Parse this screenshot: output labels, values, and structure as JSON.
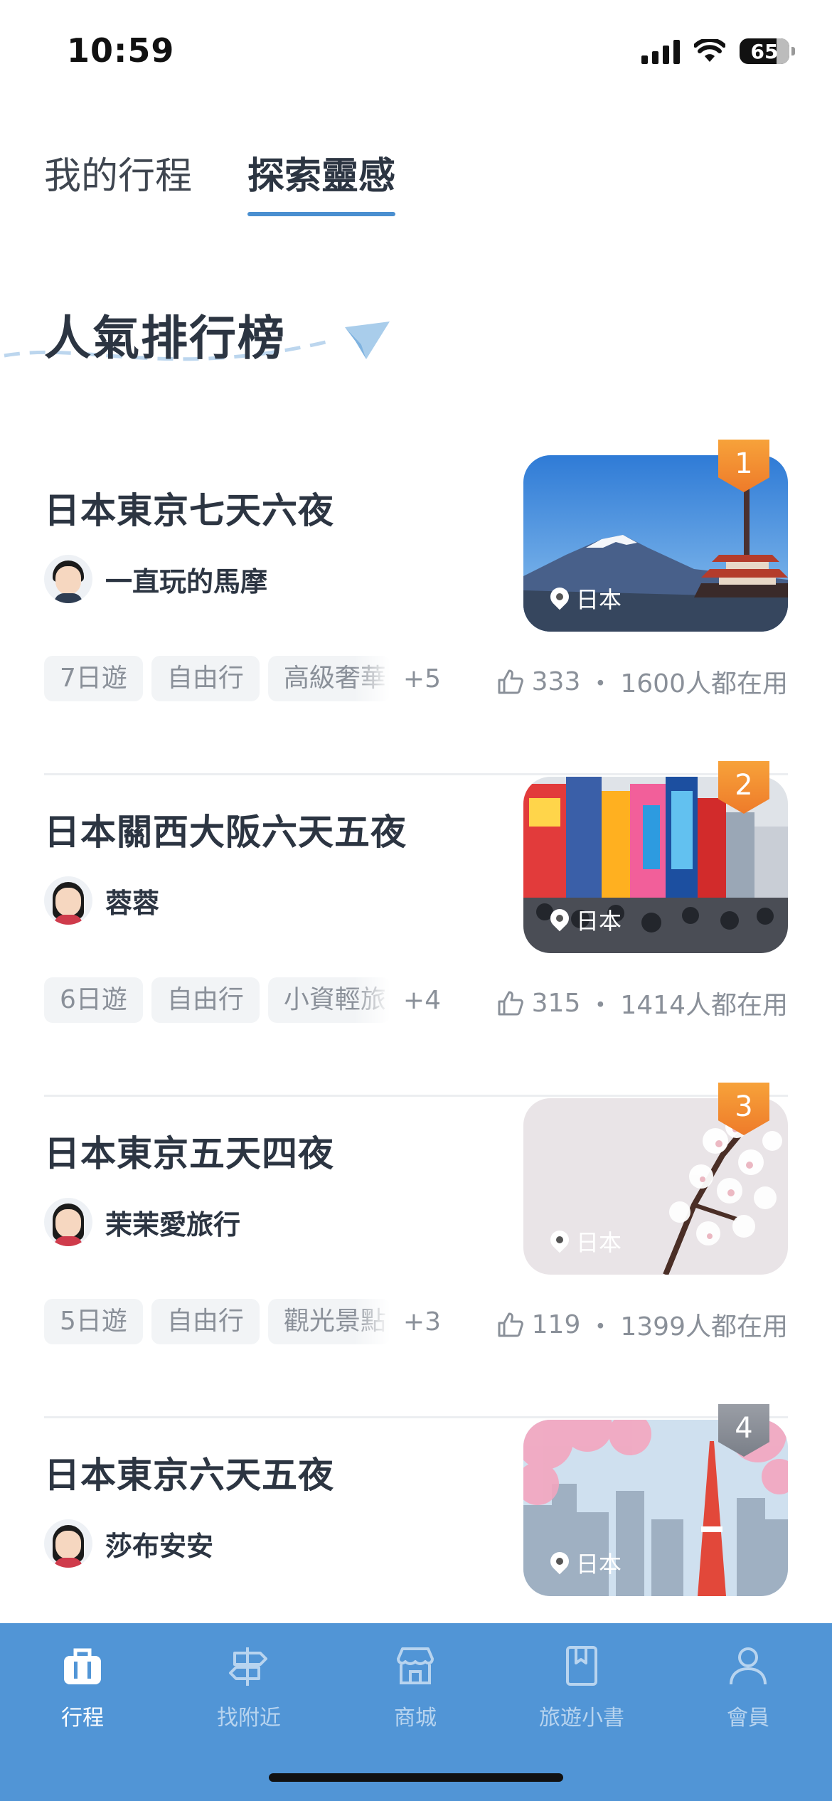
{
  "status_bar": {
    "time": "10:59",
    "battery": "65"
  },
  "tabs": [
    {
      "label": "我的行程",
      "active": false
    },
    {
      "label": "探索靈感",
      "active": true
    }
  ],
  "section": {
    "title": "人氣排行榜"
  },
  "ranking": [
    {
      "rank": "1",
      "title": "日本東京七天六夜",
      "author": "一直玩的馬摩",
      "avatar": "male",
      "location": "日本",
      "image": "mount-fuji-pagoda",
      "tags": [
        "7日遊",
        "自由行",
        "高級奢華"
      ],
      "more": "+5",
      "likes": "333",
      "users": "1600人都在用"
    },
    {
      "rank": "2",
      "title": "日本關西大阪六天五夜",
      "author": "蓉蓉",
      "avatar": "female",
      "location": "日本",
      "image": "osaka-dotonbori",
      "tags": [
        "6日遊",
        "自由行",
        "小資輕旅"
      ],
      "more": "+4",
      "likes": "315",
      "users": "1414人都在用"
    },
    {
      "rank": "3",
      "title": "日本東京五天四夜",
      "author": "茉茉愛旅行",
      "avatar": "female",
      "location": "日本",
      "image": "cherry-blossom",
      "tags": [
        "5日遊",
        "自由行",
        "觀光景點"
      ],
      "more": "+3",
      "likes": "119",
      "users": "1399人都在用"
    },
    {
      "rank": "4",
      "title": "日本東京六天五夜",
      "author": "莎布安安",
      "avatar": "female",
      "location": "日本",
      "image": "tokyo-tower-sakura"
    }
  ],
  "separator": "・",
  "bottom_nav": [
    {
      "label": "行程",
      "icon": "suitcase-icon",
      "active": true
    },
    {
      "label": "找附近",
      "icon": "signpost-icon",
      "active": false
    },
    {
      "label": "商城",
      "icon": "store-icon",
      "active": false
    },
    {
      "label": "旅遊小書",
      "icon": "book-icon",
      "active": false
    },
    {
      "label": "會員",
      "icon": "person-icon",
      "active": false
    }
  ],
  "colors": {
    "accent": "#4a8fd0",
    "nav_bg": "#5195d6",
    "badge_gold": "#f0862c",
    "badge_grey": "#8a8f97"
  }
}
